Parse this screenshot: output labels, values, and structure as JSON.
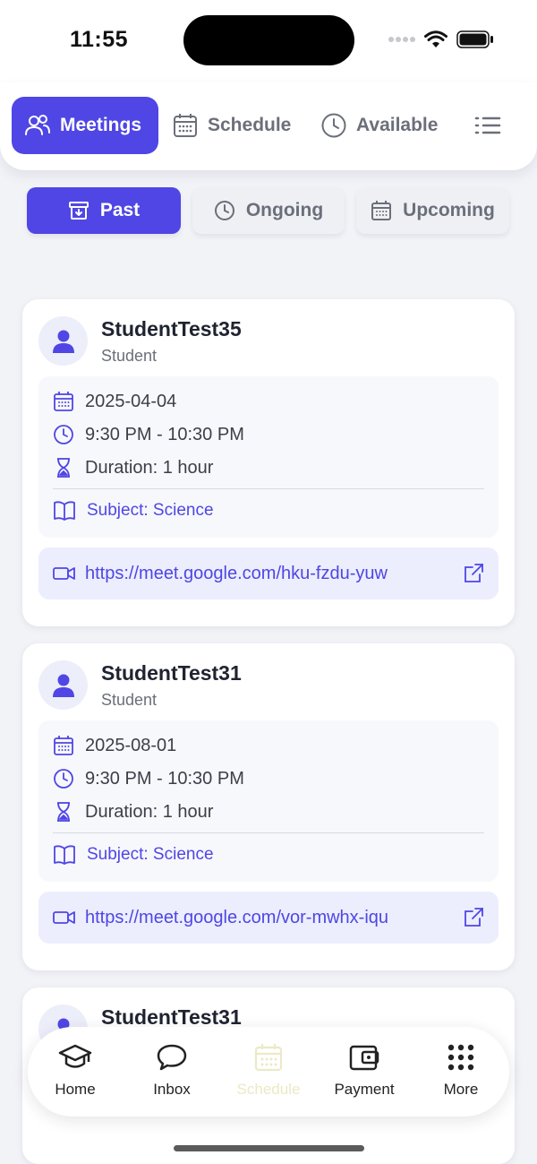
{
  "status_bar": {
    "time": "11:55"
  },
  "top_tabs": [
    {
      "label": "Meetings",
      "icon": "users-icon",
      "active": true
    },
    {
      "label": "Schedule",
      "icon": "calendar-icon",
      "active": false
    },
    {
      "label": "Available",
      "icon": "clock-icon",
      "active": false
    }
  ],
  "menu_icon": "list-icon",
  "filters": [
    {
      "label": "Past",
      "icon": "archive-icon",
      "active": true
    },
    {
      "label": "Ongoing",
      "icon": "clock-icon",
      "active": false
    },
    {
      "label": "Upcoming",
      "icon": "calendar-icon",
      "active": false
    }
  ],
  "meetings": [
    {
      "name": "StudentTest35",
      "role": "Student",
      "date": "2025-04-04",
      "time": "9:30 PM - 10:30 PM",
      "duration": "Duration: 1 hour",
      "subject": "Subject: Science",
      "link": "https://meet.google.com/hku-fzdu-yuw"
    },
    {
      "name": "StudentTest31",
      "role": "Student",
      "date": "2025-08-01",
      "time": "9:30 PM - 10:30 PM",
      "duration": "Duration: 1 hour",
      "subject": "Subject: Science",
      "link": "https://meet.google.com/vor-mwhx-iqu"
    },
    {
      "name": "StudentTest31"
    }
  ],
  "bottom_nav": [
    {
      "label": "Home",
      "icon": "graduation-cap-icon"
    },
    {
      "label": "Inbox",
      "icon": "chat-bubble-icon"
    },
    {
      "label": "Schedule",
      "icon": "calendar-icon",
      "disabled": true
    },
    {
      "label": "Payment",
      "icon": "wallet-icon"
    },
    {
      "label": "More",
      "icon": "grid-dots-icon"
    }
  ],
  "colors": {
    "accent": "#4f46e5",
    "background": "#f2f3f7"
  }
}
